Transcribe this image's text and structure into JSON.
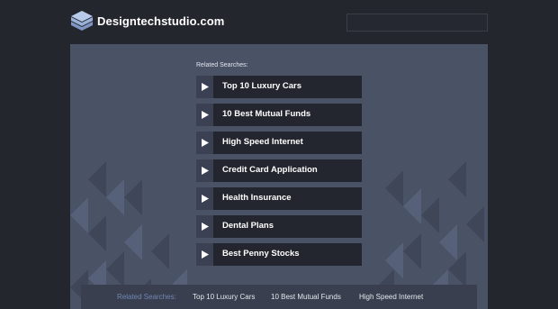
{
  "header": {
    "site_name": "Designtechstudio.com",
    "logo_icon": "layered-stack-icon",
    "search_placeholder": ""
  },
  "main": {
    "related_label": "Related Searches:",
    "links": [
      {
        "label": "Top 10 Luxury Cars",
        "icon": "play-arrow-icon"
      },
      {
        "label": "10 Best Mutual Funds",
        "icon": "play-arrow-icon"
      },
      {
        "label": "High Speed Internet",
        "icon": "play-arrow-icon"
      },
      {
        "label": "Credit Card Application",
        "icon": "play-arrow-icon"
      },
      {
        "label": "Health Insurance",
        "icon": "play-arrow-icon"
      },
      {
        "label": "Dental Plans",
        "icon": "play-arrow-icon"
      },
      {
        "label": "Best Penny Stocks",
        "icon": "play-arrow-icon"
      }
    ]
  },
  "footer_bar": {
    "label": "Related Searches:",
    "links": [
      "Top 10 Luxury Cars",
      "10 Best Mutual Funds",
      "High Speed Internet"
    ]
  },
  "colors": {
    "page_bg": "#23262d",
    "panel_bg": "#4a5266",
    "item_bg": "#23262e",
    "accent_label": "#6f86b5"
  }
}
